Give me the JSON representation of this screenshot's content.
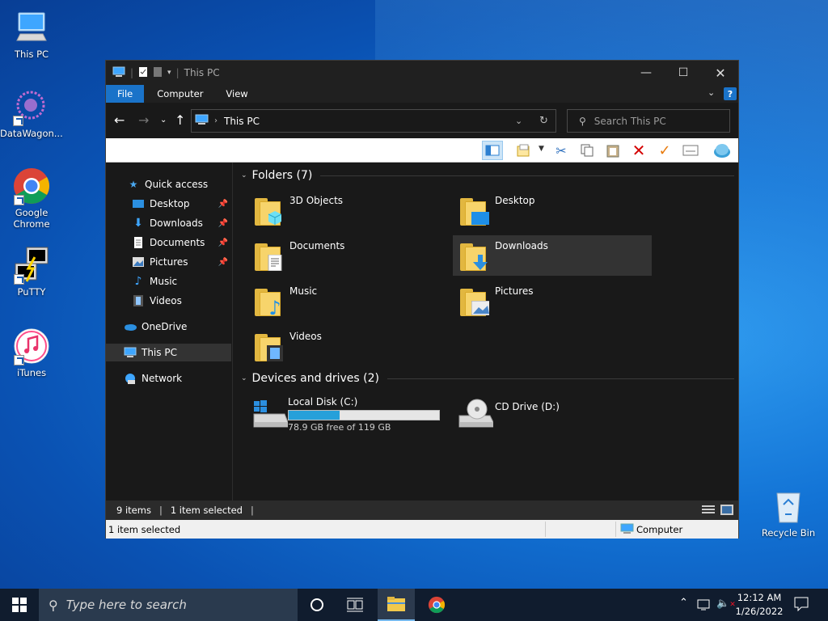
{
  "desktop": {
    "icons": [
      {
        "label": "This PC"
      },
      {
        "label": "DataWagon..."
      },
      {
        "label": "Google Chrome"
      },
      {
        "label": "PuTTY"
      },
      {
        "label": "iTunes"
      },
      {
        "label": "Recycle Bin"
      }
    ]
  },
  "window": {
    "title": "This PC",
    "menu": {
      "file": "File",
      "computer": "Computer",
      "view": "View"
    },
    "address": {
      "path": "This PC"
    },
    "search": {
      "placeholder": "Search This PC"
    },
    "nav": {
      "quick_access": "Quick access",
      "items": [
        {
          "label": "Desktop",
          "pinned": true
        },
        {
          "label": "Downloads",
          "pinned": true
        },
        {
          "label": "Documents",
          "pinned": true
        },
        {
          "label": "Pictures",
          "pinned": true
        },
        {
          "label": "Music",
          "pinned": false
        },
        {
          "label": "Videos",
          "pinned": false
        }
      ],
      "onedrive": "OneDrive",
      "this_pc": "This PC",
      "network": "Network"
    },
    "folders_header": "Folders (7)",
    "folders": [
      {
        "label": "3D Objects"
      },
      {
        "label": "Desktop"
      },
      {
        "label": "Documents"
      },
      {
        "label": "Downloads"
      },
      {
        "label": "Music"
      },
      {
        "label": "Pictures"
      },
      {
        "label": "Videos"
      }
    ],
    "devices_header": "Devices and drives (2)",
    "drives": [
      {
        "label": "Local Disk (C:)",
        "free": "78.9 GB free of 119 GB",
        "used_fraction": 0.34
      },
      {
        "label": "CD Drive (D:)"
      }
    ],
    "status": {
      "items": "9 items",
      "selected": "1 item selected"
    },
    "status2": {
      "selected": "1 item selected",
      "location": "Computer"
    }
  },
  "taskbar": {
    "search_placeholder": "Type here to search",
    "time": "12:12 AM",
    "date": "1/26/2022"
  },
  "colors": {
    "accent": "#1a73c9",
    "selected_row": "#333333",
    "window_bg": "#191919"
  }
}
